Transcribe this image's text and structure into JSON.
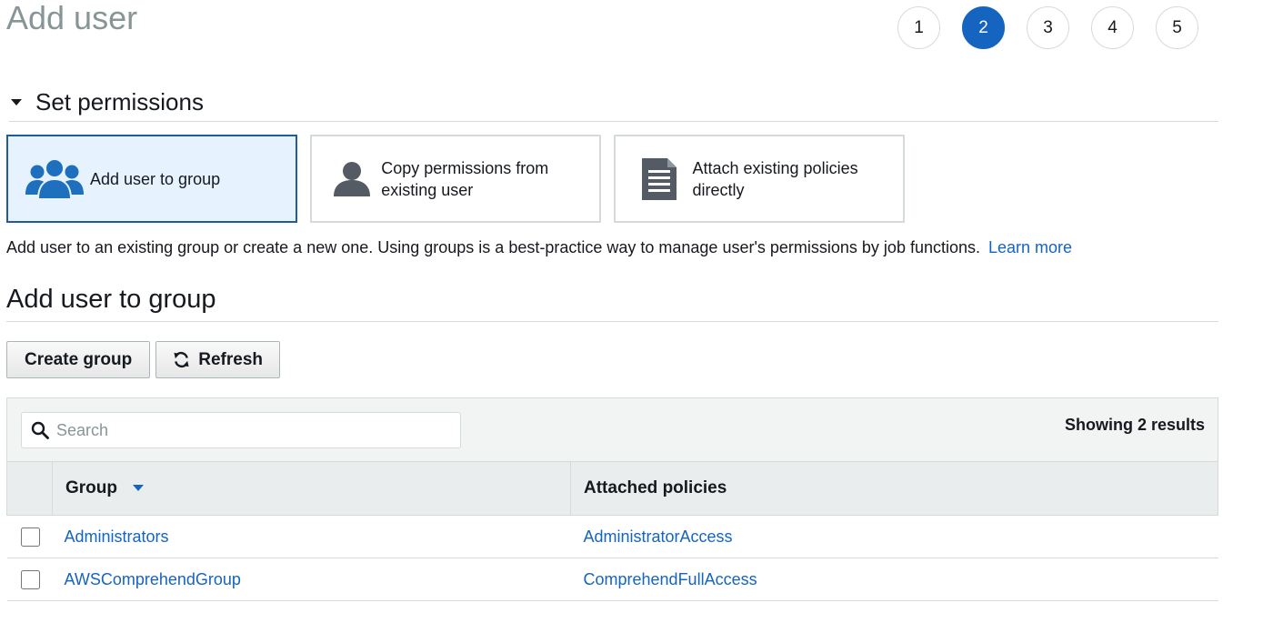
{
  "page": {
    "title": "Add user"
  },
  "steps": [
    {
      "label": "1",
      "active": false
    },
    {
      "label": "2",
      "active": true
    },
    {
      "label": "3",
      "active": false
    },
    {
      "label": "4",
      "active": false
    },
    {
      "label": "5",
      "active": false
    }
  ],
  "section": {
    "title": "Set permissions"
  },
  "tiles": [
    {
      "label": "Add user to group",
      "icon": "group-icon",
      "selected": true
    },
    {
      "label": "Copy permissions from existing user",
      "icon": "user-icon",
      "selected": false
    },
    {
      "label": "Attach existing policies directly",
      "icon": "document-icon",
      "selected": false
    }
  ],
  "description": {
    "text": "Add user to an existing group or create a new one. Using groups is a best-practice way to manage user's permissions by job functions.",
    "link": "Learn more"
  },
  "group_section": {
    "title": "Add user to group"
  },
  "toolbar": {
    "create_label": "Create group",
    "refresh_label": "Refresh"
  },
  "table": {
    "search_placeholder": "Search",
    "results_text": "Showing 2 results",
    "columns": {
      "group": "Group",
      "policies": "Attached policies"
    },
    "rows": [
      {
        "group": "Administrators",
        "policy": "AdministratorAccess",
        "checked": false
      },
      {
        "group": "AWSComprehendGroup",
        "policy": "ComprehendFullAccess",
        "checked": false
      }
    ]
  },
  "colors": {
    "accent": "#1565c0",
    "selected_tile_bg": "#e6f3ff",
    "selected_tile_border": "#1f5c99",
    "muted_title": "#879596"
  }
}
